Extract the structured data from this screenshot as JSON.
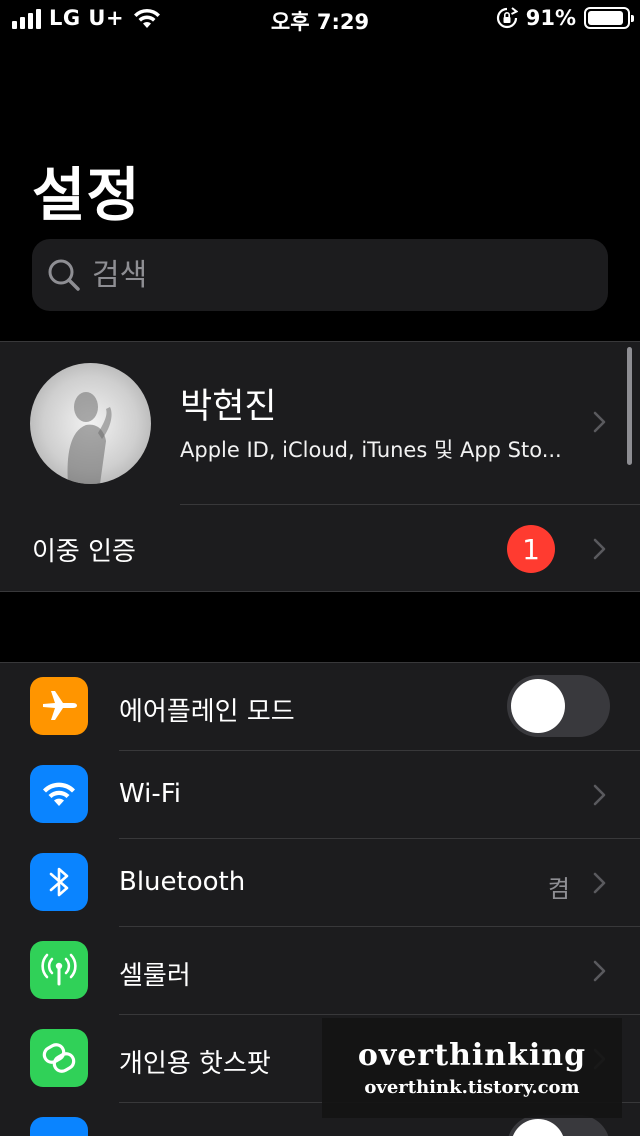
{
  "status_bar": {
    "carrier": "LG U+",
    "time": "오후 7:29",
    "battery_percent": "91%",
    "battery_level": 0.91,
    "icons": [
      "cellular-signal-icon",
      "wifi-icon",
      "rotation-lock-icon",
      "battery-icon"
    ]
  },
  "page": {
    "title": "설정"
  },
  "search": {
    "placeholder": "검색",
    "icon": "search-icon"
  },
  "profile": {
    "name": "박현진",
    "subtitle": "Apple ID, iCloud, iTunes 및 App Sto...",
    "two_factor_label": "이중 인증",
    "two_factor_badge": "1"
  },
  "settings": {
    "items": [
      {
        "label": "에어플레인 모드",
        "icon": "airplane-icon",
        "icon_color": "#ff9500",
        "toggle_on": false
      },
      {
        "label": "Wi-Fi",
        "icon": "wifi-icon",
        "icon_color": "#0a84ff"
      },
      {
        "label": "Bluetooth",
        "icon": "bluetooth-icon",
        "icon_color": "#0a84ff",
        "value": "켬"
      },
      {
        "label": "셀룰러",
        "icon": "antenna-icon",
        "icon_color": "#30d158"
      },
      {
        "label": "개인용 핫스팟",
        "icon": "chain-link-icon",
        "icon_color": "#30d158"
      },
      {
        "icon_color": "#0a84ff",
        "toggle_on": false
      }
    ]
  },
  "watermark": {
    "title": "overthinking",
    "url": "overthink.tistory.com"
  },
  "colors": {
    "background": "#000000",
    "cell_background": "#1c1c1e",
    "separator": "#38383a",
    "badge": "#ff3b30",
    "secondary_text": "#8e8e93"
  }
}
